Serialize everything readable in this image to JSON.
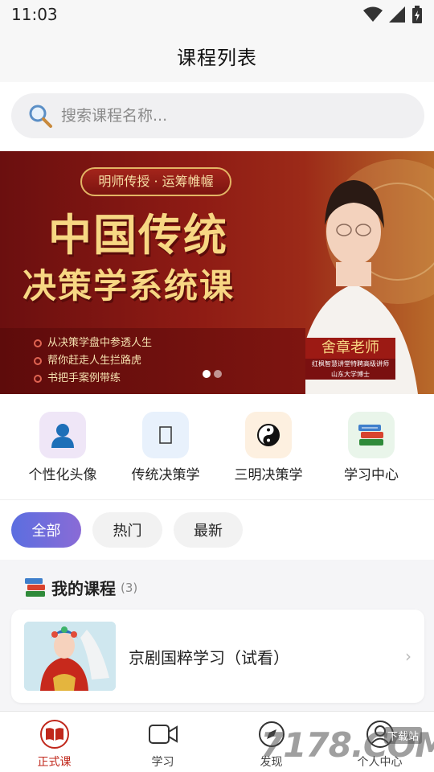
{
  "status_bar": {
    "time": "11:03"
  },
  "header": {
    "title": "课程列表"
  },
  "search": {
    "placeholder": "搜索课程名称..."
  },
  "banner": {
    "tag": "明师传授 · 运筹帷幄",
    "headline": "中国传统",
    "subheadline": "决策学系统课",
    "bullets": [
      "从决策学盘中参透人生",
      "帮你赶走人生拦路虎",
      "书把手案例带练"
    ],
    "teacher_name": "舍章老师",
    "teacher_title": "红枫智慧讲堂特聘高级讲师",
    "teacher_school": "山东大学博士",
    "slide_count": 2,
    "active_slide": 1
  },
  "quick_menu": [
    {
      "label": "个性化头像",
      "icon": "avatar-icon"
    },
    {
      "label": "传统决策学",
      "icon": "tradition-icon"
    },
    {
      "label": "三明决策学",
      "icon": "yin-yang-icon"
    },
    {
      "label": "学习中心",
      "icon": "books-icon"
    }
  ],
  "filters": {
    "all": "全部",
    "hot": "热门",
    "latest": "最新"
  },
  "my_courses": {
    "title": "我的课程",
    "count": "(3)",
    "items": [
      {
        "name": "京剧国粹学习（试看）"
      }
    ]
  },
  "bottom_nav": [
    {
      "label": "正式课",
      "active": true
    },
    {
      "label": "学习",
      "active": false
    },
    {
      "label": "发现",
      "active": false
    },
    {
      "label": "个人中心",
      "active": false
    }
  ],
  "watermark": {
    "text": "7178.COM",
    "tag": "下载站"
  },
  "colors": {
    "accent_red": "#c0271b",
    "chip_gradient_start": "#5b6ee0",
    "chip_gradient_end": "#8a6bd6"
  }
}
